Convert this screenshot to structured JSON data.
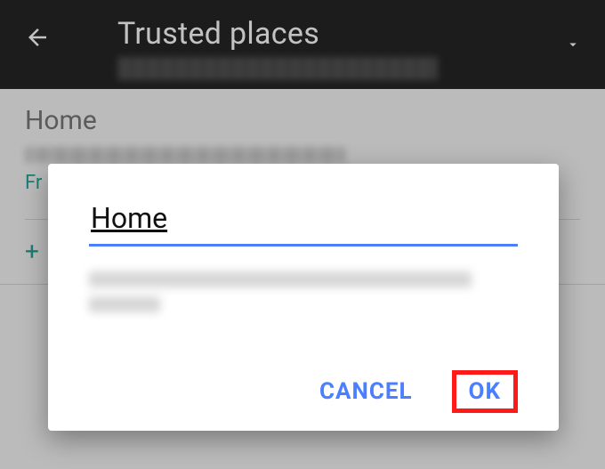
{
  "appbar": {
    "title": "Trusted places"
  },
  "list": {
    "item_title": "Home",
    "item_action_prefix": "Fr"
  },
  "add": {
    "plus": "+"
  },
  "dialog": {
    "input_value": "Home",
    "cancel_label": "CANCEL",
    "ok_label": "OK"
  },
  "colors": {
    "accent_link": "#4a80ff",
    "teal": "#009688",
    "highlight": "#ff1a1a"
  }
}
